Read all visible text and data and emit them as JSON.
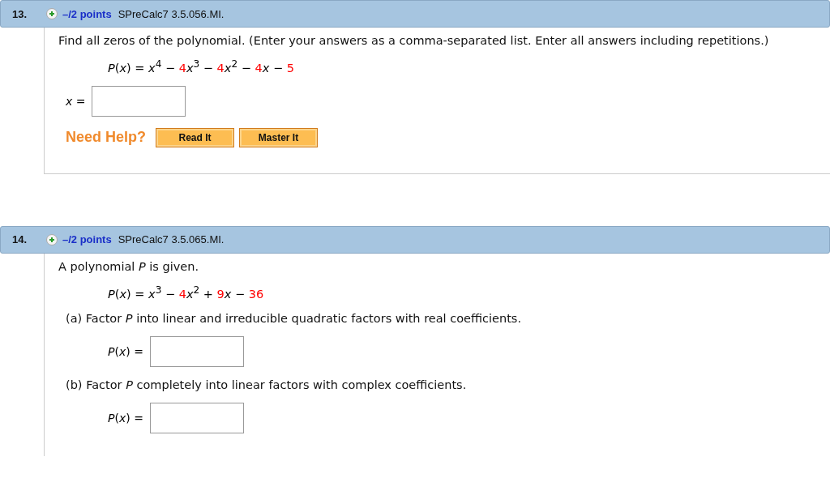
{
  "questions": [
    {
      "number": "13.",
      "points": "–/2 points",
      "source": "SPreCalc7 3.5.056.MI.",
      "parts": [
        {
          "kind": "text",
          "text": "Find all zeros of the polynomial. (Enter your answers as a comma-separated list. Enter all answers including repetitions.)"
        },
        {
          "kind": "equation",
          "terms": [
            {
              "text": "*P*(*x*) = *x*$^{4}$ − ",
              "color": "#000000"
            },
            {
              "text": "4",
              "color": "#ff0000"
            },
            {
              "text": "*x*$^{3}$ − ",
              "color": "#000000"
            },
            {
              "text": "4",
              "color": "#ff0000"
            },
            {
              "text": "*x*$^{2}$ − ",
              "color": "#000000"
            },
            {
              "text": "4",
              "color": "#ff0000"
            },
            {
              "text": "*x* − ",
              "color": "#000000"
            },
            {
              "text": "5",
              "color": "#ff0000"
            }
          ]
        },
        {
          "kind": "answer",
          "label": "*x* ="
        },
        {
          "kind": "help",
          "label": "Need Help?",
          "buttons": [
            "Read It",
            "Master It"
          ]
        }
      ]
    },
    {
      "number": "14.",
      "points": "–/2 points",
      "source": "SPreCalc7 3.5.065.MI.",
      "parts": [
        {
          "kind": "text",
          "text": "A polynomial *P* is given."
        },
        {
          "kind": "equation",
          "terms": [
            {
              "text": "*P*(*x*) = *x*$^{3}$ − ",
              "color": "#000000"
            },
            {
              "text": "4",
              "color": "#ff0000"
            },
            {
              "text": "*x*$^{2}$ + ",
              "color": "#000000"
            },
            {
              "text": "9",
              "color": "#ff0000"
            },
            {
              "text": "*x* − ",
              "color": "#000000"
            },
            {
              "text": "36",
              "color": "#ff0000"
            }
          ]
        },
        {
          "kind": "subtext",
          "text": "(a) Factor *P* into linear and irreducible quadratic factors with real coefficients."
        },
        {
          "kind": "answer",
          "label": "*P*(*x*) ="
        },
        {
          "kind": "subtext",
          "text": "(b) Factor *P* completely into linear factors with complex coefficients."
        },
        {
          "kind": "answer",
          "label": "*P*(*x*) ="
        }
      ]
    }
  ]
}
